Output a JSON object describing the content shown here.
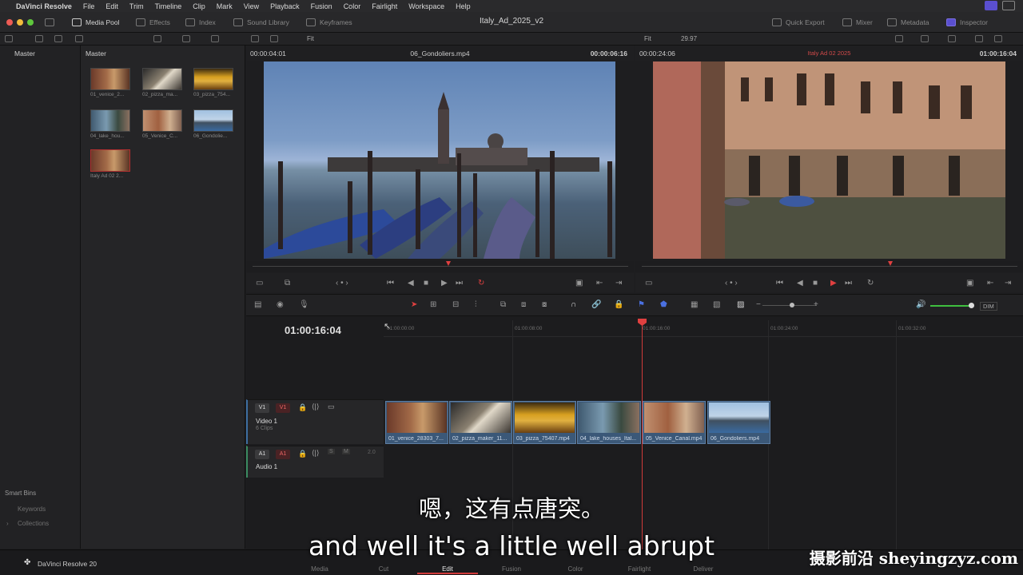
{
  "menubar": {
    "app": "DaVinci Resolve",
    "items": [
      "File",
      "Edit",
      "Trim",
      "Timeline",
      "Clip",
      "Mark",
      "View",
      "Playback",
      "Fusion",
      "Color",
      "Fairlight",
      "Workspace",
      "Help"
    ]
  },
  "toolbar": {
    "project_title": "Italy_Ad_2025_v2",
    "media_pool": "Media Pool",
    "effects": "Effects",
    "index": "Index",
    "sound_library": "Sound Library",
    "keyframes": "Keyframes",
    "quick_export": "Quick Export",
    "mixer": "Mixer",
    "metadata": "Metadata",
    "inspector": "Inspector"
  },
  "subbar": {
    "source_zoom": "Fit",
    "timeline_zoom": "Fit",
    "framerate": "29.97"
  },
  "bins": {
    "master": "Master",
    "smart_bins": "Smart Bins",
    "keywords": "Keywords",
    "collections": "Collections"
  },
  "pool": {
    "header": "Master",
    "clips": [
      {
        "name": "01_venice_2..."
      },
      {
        "name": "02_pizza_ma..."
      },
      {
        "name": "03_pizza_754..."
      },
      {
        "name": "04_lake_hou..."
      },
      {
        "name": "05_Venice_C..."
      },
      {
        "name": "06_Gondolie..."
      },
      {
        "name": "Italy Ad 02 2..."
      }
    ]
  },
  "source_viewer": {
    "tc_left": "00:00:04:01",
    "clip_name": "06_Gondoliers.mp4",
    "tc_right": "00:00:06:16"
  },
  "timeline_viewer": {
    "tc_left": "00:00:24:06",
    "timeline_name": "Italy Ad 02 2025",
    "tc_right": "01:00:16:04"
  },
  "timeline": {
    "timecode": "01:00:16:04",
    "ruler": [
      "01:00:00:00",
      "01:00:08:00",
      "01:00:16:00",
      "01:00:24:00",
      "01:00:32:00"
    ],
    "video_track": {
      "btn": "V1",
      "name": "Video 1",
      "info": "6 Clips"
    },
    "audio_track": {
      "btn": "A1",
      "name": "Audio 1",
      "level": "2.0"
    },
    "dim": "DIM",
    "clips": [
      {
        "name": "01_venice_28303_7..."
      },
      {
        "name": "02_pizza_maker_11..."
      },
      {
        "name": "03_pizza_75407.mp4"
      },
      {
        "name": "04_lake_houses_Ital..."
      },
      {
        "name": "05_Venice_Canal.mp4"
      },
      {
        "name": "06_Gondoliers.mp4"
      }
    ]
  },
  "pages": [
    "Media",
    "Cut",
    "Edit",
    "Fusion",
    "Color",
    "Fairlight",
    "Deliver"
  ],
  "active_page": "Edit",
  "brand": "DaVinci Resolve 20",
  "subtitles": {
    "cn": "嗯，这有点唐突。",
    "en": "and well it's a little well abrupt"
  },
  "watermark": "摄影前沿 sheyingzyz.com"
}
